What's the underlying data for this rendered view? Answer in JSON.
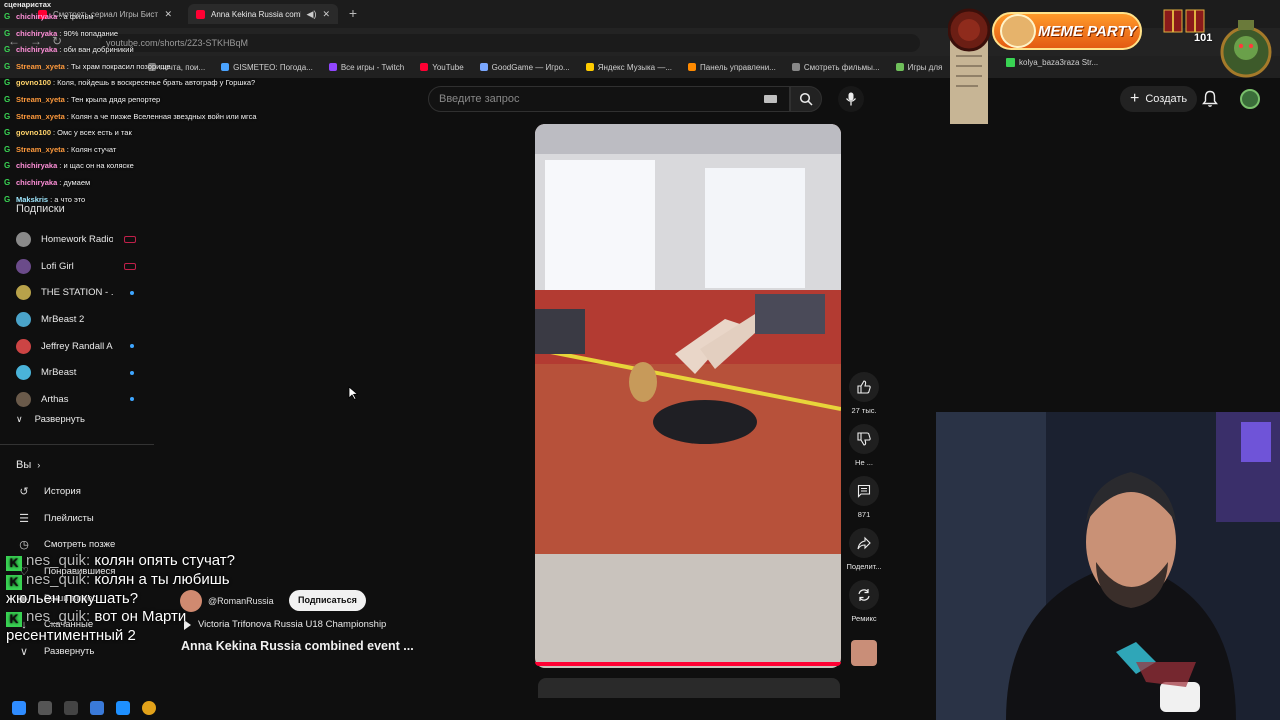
{
  "browser": {
    "tabs": [
      {
        "label": "Смотреть сериал Игры Биста",
        "active": false
      },
      {
        "label": "Anna Kekina Russia combine",
        "active": true
      }
    ],
    "url": "youtube.com/shorts/2Z3-STKHBqM",
    "bookmarks": [
      "почта, пои...",
      "GISMETEO: Погода...",
      "Все игры - Twitch",
      "YouTube",
      "GoodGame — Игро...",
      "Яндекс Музыка —...",
      "Панель управлени...",
      "Смотреть фильмы...",
      "Игры для"
    ],
    "kick_tab": "kolya_baza3raza Str..."
  },
  "header": {
    "search_placeholder": "Введите запрос",
    "create_label": "Создать"
  },
  "sidebar": {
    "subscriptions_title": "Подписки",
    "subscriptions": [
      {
        "label": "Homework Radio",
        "badge": "live",
        "color": "#8a8a8a"
      },
      {
        "label": "Lofi Girl",
        "badge": "live",
        "color": "#6b4b8a"
      },
      {
        "label": "THE STATION - ...",
        "badge": "new",
        "color": "#b8a24a"
      },
      {
        "label": "MrBeast 2",
        "badge": "",
        "color": "#4aa3c9"
      },
      {
        "label": "Jeffrey Randall A...",
        "badge": "new",
        "color": "#c44"
      },
      {
        "label": "MrBeast",
        "badge": "new",
        "color": "#4ab3d9"
      },
      {
        "label": "Arthas",
        "badge": "new",
        "color": "#6a5a4a"
      }
    ],
    "expand_label": "Развернуть",
    "you_title": "Вы",
    "you_items": [
      {
        "label": "История",
        "icon": "history-icon"
      },
      {
        "label": "Плейлисты",
        "icon": "playlist-icon"
      },
      {
        "label": "Смотреть позже",
        "icon": "watch-later-icon"
      },
      {
        "label": "Понравившиеся",
        "icon": "like-icon"
      },
      {
        "label": "Ваши видео",
        "icon": "video-icon"
      },
      {
        "label": "Скачанные",
        "icon": "download-icon"
      },
      {
        "label": "Развернуть",
        "icon": "chevron-down-icon"
      }
    ]
  },
  "short": {
    "channel": "@RomanRussia",
    "subscribe_label": "Подписаться",
    "music": "Victoria Trifonova Russia U18 Championship",
    "title": "Anna Kekina Russia combined event ...",
    "actions": [
      {
        "name": "like",
        "label": "27 тыс."
      },
      {
        "name": "dislike",
        "label": "Не ..."
      },
      {
        "name": "comments",
        "label": "871"
      },
      {
        "name": "share",
        "label": "Поделит..."
      },
      {
        "name": "remix",
        "label": "Ремикс"
      }
    ]
  },
  "chat": {
    "header": "сценаристах",
    "small": [
      {
        "user": "chichiryaka",
        "text": ": а фильм",
        "color": "#ff8fd8"
      },
      {
        "user": "chichiryaka",
        "text": ": 90% попадание",
        "color": "#ff8fd8"
      },
      {
        "user": "chichiryaka",
        "text": ": оби ван добриникий",
        "color": "#ff8fd8"
      },
      {
        "user": "Stream_xyeta",
        "text": ": Ты храм покрасил позорище",
        "color": "#ff9a3c"
      },
      {
        "user": "govno100",
        "text": ": Коля, пойдешь в воскресенье брать автограф у Горшка?",
        "color": "#ffd36b"
      },
      {
        "user": "Stream_xyeta",
        "text": ": Тен крыла дядя репортер",
        "color": "#ff9a3c"
      },
      {
        "user": "Stream_xyeta",
        "text": ": Колян а че пизже Вселенная звездных войн или мгса",
        "color": "#ff9a3c"
      },
      {
        "user": "govno100",
        "text": ": Омс у всех есть и так",
        "color": "#ffd36b"
      },
      {
        "user": "Stream_xyeta",
        "text": ": Колян стучат",
        "color": "#ff9a3c"
      },
      {
        "user": "chichiryaka",
        "text": ": и щас он на коляске",
        "color": "#ff8fd8"
      },
      {
        "user": "chichiryaka",
        "text": ": думаем",
        "color": "#ff8fd8"
      },
      {
        "user": "Makskris",
        "text": ": а что это",
        "color": "#9fe8ff"
      }
    ],
    "big": [
      {
        "user": "nes_quik:",
        "text": "колян опять стучат?"
      },
      {
        "user": "nes_quik:",
        "text": "колян а ты любишь"
      },
      {
        "user": "",
        "text": "жюльен покушать?"
      },
      {
        "user": "nes_quik:",
        "text": "вот он Марти"
      },
      {
        "user": "",
        "text": "ресентиментный 2"
      }
    ]
  },
  "overlay": {
    "meme_party": "MEME PARTY",
    "kill_count": "101"
  },
  "colors": {
    "accent_red": "#ff0033",
    "kick_green": "#39d353"
  }
}
